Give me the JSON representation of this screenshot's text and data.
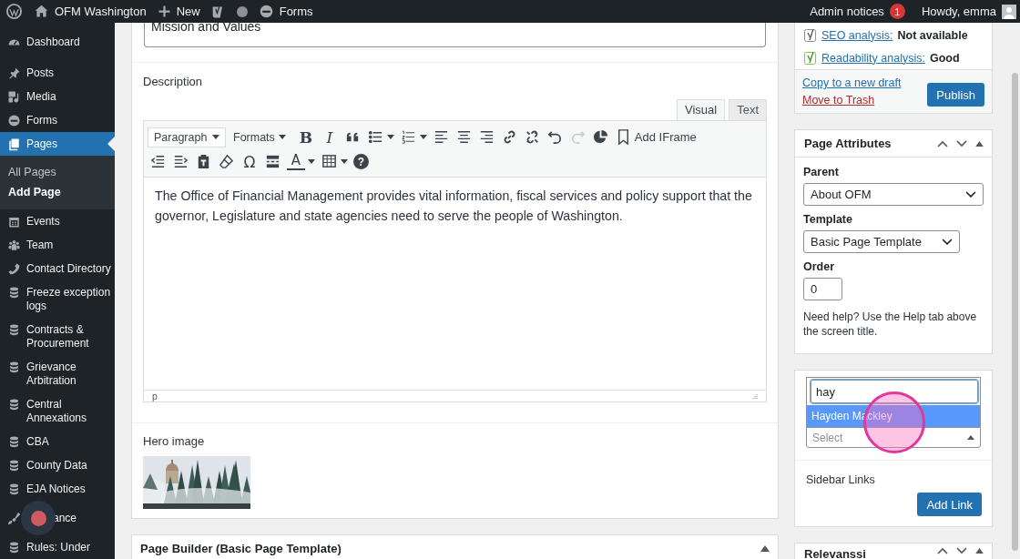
{
  "admin_bar": {
    "site_name": "OFM Washington",
    "new_label": "New",
    "forms_label": "Forms",
    "notices_label": "Admin notices",
    "notices_count": "1",
    "greeting": "Howdy, emma"
  },
  "sidebar": {
    "items": [
      {
        "label": "Dashboard",
        "kind": "gauge",
        "selected": false,
        "overlaid": false
      },
      {
        "label": "Posts",
        "kind": "pin",
        "selected": false,
        "overlaid": false
      },
      {
        "label": "Media",
        "kind": "media",
        "selected": false,
        "overlaid": false
      },
      {
        "label": "Forms",
        "kind": "forms",
        "selected": false,
        "overlaid": false
      },
      {
        "label": "Pages",
        "kind": "pages",
        "selected": true,
        "overlaid": false,
        "children": [
          {
            "label": "All Pages",
            "selected": false
          },
          {
            "label": "Add Page",
            "selected": true
          }
        ]
      },
      {
        "label": "Events",
        "kind": "calendar",
        "selected": false,
        "overlaid": false
      },
      {
        "label": "Team",
        "kind": "team",
        "selected": false,
        "overlaid": false
      },
      {
        "label": "Contact Directory",
        "kind": "phone",
        "selected": false,
        "overlaid": false
      },
      {
        "label": "Freeze exception logs",
        "kind": "database",
        "selected": false,
        "overlaid": false
      },
      {
        "label": "Contracts & Procurement",
        "kind": "database",
        "selected": false,
        "overlaid": false
      },
      {
        "label": "Grievance Arbitration",
        "kind": "database",
        "selected": false,
        "overlaid": false
      },
      {
        "label": "Central Annexations",
        "kind": "database",
        "selected": false,
        "overlaid": false
      },
      {
        "label": "CBA",
        "kind": "database",
        "selected": false,
        "overlaid": false
      },
      {
        "label": "County Data",
        "kind": "database",
        "selected": false,
        "overlaid": false
      },
      {
        "label": "EJA Notices",
        "kind": "database",
        "selected": false,
        "overlaid": false
      },
      {
        "label": "ance",
        "kind": "brush",
        "selected": false,
        "overlaid": true
      },
      {
        "label": "Rules: Under",
        "kind": "database",
        "selected": false,
        "overlaid": false
      }
    ]
  },
  "main": {
    "title_value": "Mission and Values",
    "description": {
      "label": "Description",
      "tabs": [
        {
          "label": "Visual",
          "selected": true
        },
        {
          "label": "Text",
          "selected": false
        }
      ],
      "block_format": "Paragraph",
      "formats_label": "Formats",
      "toolbar_rows": [
        [
          {
            "kind": "bold",
            "glyph": "B",
            "caret": false,
            "disabled": false
          },
          {
            "kind": "italic",
            "glyph": "I",
            "caret": false,
            "disabled": false
          },
          {
            "kind": "blockquote",
            "caret": false,
            "disabled": false
          },
          {
            "kind": "bullet-list",
            "caret": true,
            "disabled": false
          },
          {
            "kind": "numbered-list",
            "caret": true,
            "disabled": false
          },
          {
            "kind": "align-left",
            "caret": false,
            "disabled": false
          },
          {
            "kind": "align-center",
            "caret": false,
            "disabled": false
          },
          {
            "kind": "align-right",
            "caret": false,
            "disabled": false
          },
          {
            "kind": "link",
            "caret": false,
            "disabled": false
          },
          {
            "kind": "unlink",
            "caret": false,
            "disabled": false
          },
          {
            "kind": "undo",
            "caret": false,
            "disabled": false
          },
          {
            "kind": "redo",
            "caret": false,
            "disabled": true
          },
          {
            "kind": "pie-chart",
            "caret": false,
            "disabled": false
          },
          {
            "kind": "iframe",
            "label": "Add IFrame",
            "caret": false,
            "disabled": false
          }
        ],
        [
          {
            "kind": "outdent",
            "caret": false,
            "disabled": false
          },
          {
            "kind": "indent",
            "caret": false,
            "disabled": false
          },
          {
            "kind": "paste-text",
            "caret": false,
            "disabled": false
          },
          {
            "kind": "eraser",
            "caret": false,
            "disabled": false
          },
          {
            "kind": "special-character",
            "glyph": "Ω",
            "caret": false,
            "disabled": false
          },
          {
            "kind": "read-more",
            "caret": false,
            "disabled": false
          },
          {
            "kind": "text-color",
            "glyph": "A",
            "caret": true,
            "disabled": false
          },
          {
            "kind": "table",
            "caret": true,
            "disabled": false
          },
          {
            "kind": "help",
            "glyph": "?",
            "caret": false,
            "disabled": false
          }
        ]
      ],
      "content": "The Office of Financial Management provides vital information, fiscal services and policy support that the governor, Legislature and state agencies need to serve the people of Washington.",
      "path": "p"
    },
    "hero": {
      "label": "Hero image",
      "kind": "picture"
    },
    "page_builder": {
      "title": "Page Builder (Basic Page Template)"
    }
  },
  "publish": {
    "analyses": [
      {
        "label": "SEO analysis:",
        "value": "Not available",
        "kind": "neutral"
      },
      {
        "label": "Readability analysis:",
        "value": "Good",
        "kind": "good"
      }
    ],
    "copy_link": "Copy to a new draft",
    "trash_link": "Move to Trash",
    "publish_button": "Publish"
  },
  "page_attributes": {
    "title": "Page Attributes",
    "parent_label": "Parent",
    "parent_value": "About OFM",
    "template_label": "Template",
    "template_value": "Basic Page Template",
    "order_label": "Order",
    "order_value": "0",
    "help": "Need help? Use the Help tab above the screen title."
  },
  "person_box": {
    "search_value": "hay",
    "options": [
      {
        "label": "Hayden Mackley",
        "selected": true
      }
    ],
    "select_placeholder": "Select",
    "sidebar_links_label": "Sidebar Links",
    "add_link_button": "Add Link"
  },
  "relevanssi": {
    "title": "Relevanssi"
  }
}
